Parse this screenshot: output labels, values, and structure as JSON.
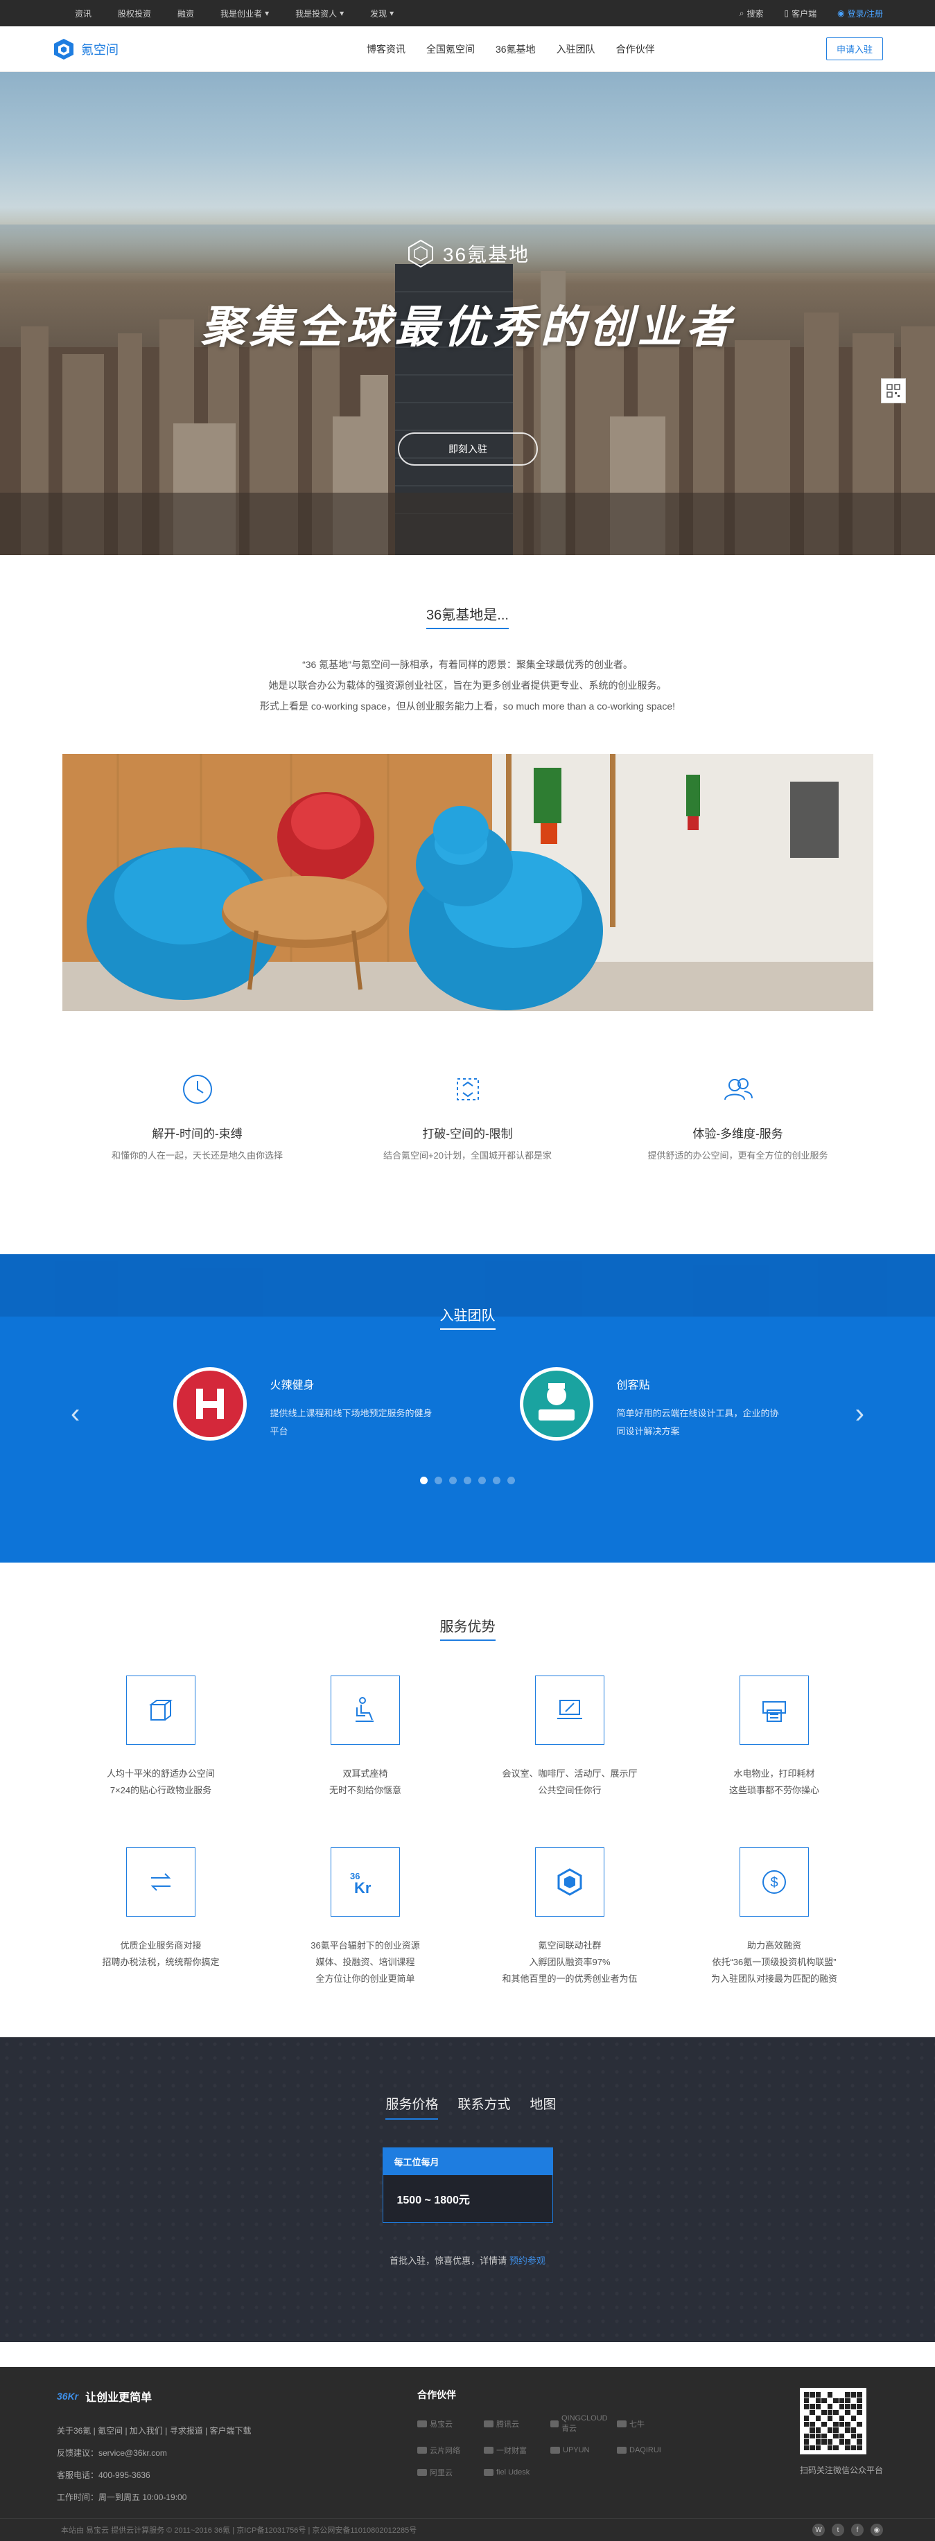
{
  "topbar": {
    "left": [
      "资讯",
      "股权投资",
      "融资",
      "我是创业者",
      "我是投资人",
      "发现"
    ],
    "search": "搜索",
    "client": "客户端",
    "login": "登录/注册"
  },
  "header": {
    "logo_text": "氪空间",
    "nav": [
      "博客资讯",
      "全国氪空间",
      "36氪基地",
      "入驻团队",
      "合作伙伴"
    ],
    "apply": "申请入驻"
  },
  "hero": {
    "brand": "36氪基地",
    "slogan": "聚集全球最优秀的创业者",
    "button": "即刻入驻"
  },
  "about": {
    "title": "36氪基地是...",
    "lines": [
      "“36 氪基地”与氪空间一脉相承，有着同样的愿景：聚集全球最优秀的创业者。",
      "她是以联合办公为载体的强资源创业社区，旨在为更多创业者提供更专业、系统的创业服务。",
      "形式上看是 co-working space，但从创业服务能力上看，so much more than a co-working space!"
    ],
    "features": [
      {
        "title": "解开-时间的-束缚",
        "desc": "和懂你的人在一起，天长还是地久由你选择"
      },
      {
        "title": "打破-空间的-限制",
        "desc": "结合氪空间+20计划，全国城开都认都是家"
      },
      {
        "title": "体验-多维度-服务",
        "desc": "提供舒适的办公空间，更有全方位的创业服务"
      }
    ]
  },
  "teams": {
    "title": "入驻团队",
    "items": [
      {
        "name": "火辣健身",
        "desc": "提供线上课程和线下场地预定服务的健身平台",
        "avatar_color": "#d4283a"
      },
      {
        "name": "创客贴",
        "desc": "简单好用的云端在线设计工具，企业的协同设计解决方案",
        "avatar_color": "#1aa3a0"
      }
    ],
    "dots": 7
  },
  "advantages": {
    "title": "服务优势",
    "items": [
      {
        "icon": "cube-icon",
        "text": "人均十平米的舒适办公空间\n7×24的贴心行政物业服务"
      },
      {
        "icon": "chair-icon",
        "text": "双耳式座椅\n无时不刻给你惬意"
      },
      {
        "icon": "laptop-icon",
        "text": "会议室、咖啡厅、活动厅、展示厅\n公共空间任你行"
      },
      {
        "icon": "printer-icon",
        "text": "水电物业，打印耗材\n这些琐事都不劳你操心"
      },
      {
        "icon": "swap-arrows-icon",
        "text": "优质企业服务商对接\n招聘办税法税，统统帮你搞定"
      },
      {
        "icon": "36kr-icon",
        "text": "36氪平台辐射下的创业资源\n媒体、投融资、培训课程\n全方位让你的创业更简单"
      },
      {
        "icon": "hexagon-icon",
        "text": "氪空间联动社群\n入孵团队融资率97%\n和其他百里的一的优秀创业者为伍"
      },
      {
        "icon": "dollar-icon",
        "text": "助力高效融资\n依托“36氪一顶级投资机构联盟”\n为入驻团队对接最为匹配的融资"
      }
    ]
  },
  "pricing": {
    "tabs": [
      "服务价格",
      "联系方式",
      "地图"
    ],
    "card_head": "每工位每月",
    "card_price": "1500 ~ 1800元",
    "note": "首批入驻，惊喜优惠，详情请",
    "note_link": "预约参观"
  },
  "footer": {
    "brand_kr": "36Kr",
    "brand": "让创业更简单",
    "links": "关于36氪 | 氪空间 | 加入我们 | 寻求报道 | 客户端下载",
    "feedback": "反馈建议：service@36kr.com",
    "phone": "客服电话：400-995-3636",
    "hours": "工作时间：周一到周五 10:00-19:00",
    "partners_title": "合作伙伴",
    "partners": [
      "易宝云",
      "腾讯云",
      "QINGCLOUD青云",
      "七牛",
      "云片网络",
      "一财财富",
      "UPYUN",
      "DAQIRUI",
      "阿里云",
      "fiel Udesk"
    ],
    "qr_caption": "扫码关注微信公众平台",
    "copyright": "本站由 易宝云 提供云计算服务   © 2011~2016 36氪 | 京ICP备12031756号 | 京公网安备11010802012285号"
  }
}
